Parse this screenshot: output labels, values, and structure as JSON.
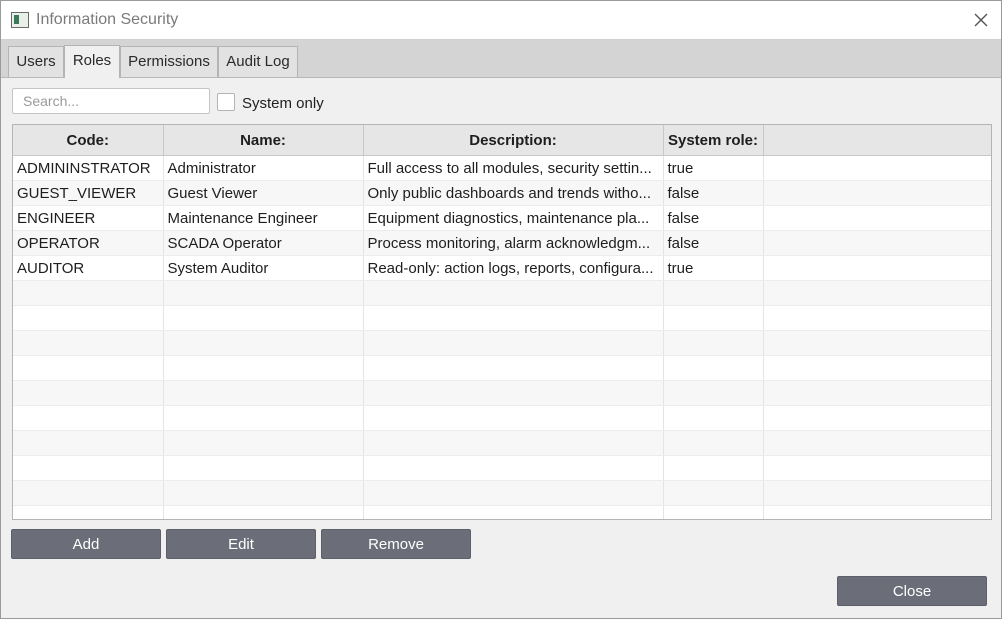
{
  "window": {
    "title": "Information Security"
  },
  "tabs": [
    {
      "label": "Users"
    },
    {
      "label": "Roles"
    },
    {
      "label": "Permissions"
    },
    {
      "label": "Audit Log"
    }
  ],
  "active_tab": "Roles",
  "filter": {
    "search_value": "",
    "search_placeholder": "Search...",
    "system_only_label": "System only",
    "system_only_checked": false
  },
  "table": {
    "headers": [
      "Code:",
      "Name:",
      "Description:",
      "System role:",
      ""
    ],
    "rows": [
      [
        "ADMININSTRATOR",
        "Administrator",
        "Full access to all modules, security settin...",
        "true"
      ],
      [
        "GUEST_VIEWER",
        "Guest Viewer",
        "Only public dashboards and trends witho...",
        "false"
      ],
      [
        "ENGINEER",
        "Maintenance Engineer",
        "Equipment diagnostics, maintenance pla...",
        "false"
      ],
      [
        "OPERATOR",
        "SCADA Operator",
        "Process monitoring, alarm acknowledgm...",
        "false"
      ],
      [
        "AUDITOR",
        "System Auditor",
        "Read-only: action logs, reports, configura...",
        "true"
      ]
    ]
  },
  "buttons": {
    "add": "Add",
    "edit": "Edit",
    "remove": "Remove",
    "close": "Close"
  },
  "colors": {
    "button_bg": "#6b6e78",
    "header_bg": "#e6e6e6",
    "tabstrip_bg": "#d4d4d4"
  }
}
